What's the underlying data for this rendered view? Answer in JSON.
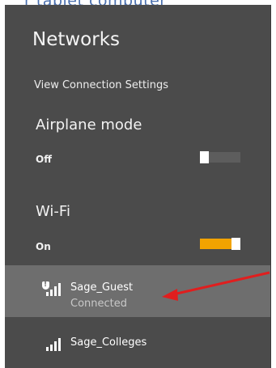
{
  "page": {
    "top_text": "r tablet computer"
  },
  "networks_panel": {
    "title": "Networks",
    "view_connection_settings": "View Connection Settings",
    "airplane_mode": {
      "label": "Airplane mode",
      "state": "Off",
      "on": false
    },
    "wifi": {
      "label": "Wi-Fi",
      "state": "On",
      "on": true,
      "accent": "#f2a300"
    },
    "networks": [
      {
        "name": "Sage_Guest",
        "status": "Connected",
        "secured_warning": true
      },
      {
        "name": "Sage_Colleges",
        "status": "",
        "secured_warning": false
      }
    ]
  },
  "annotation": {
    "arrow_color": "#e01e1e"
  }
}
